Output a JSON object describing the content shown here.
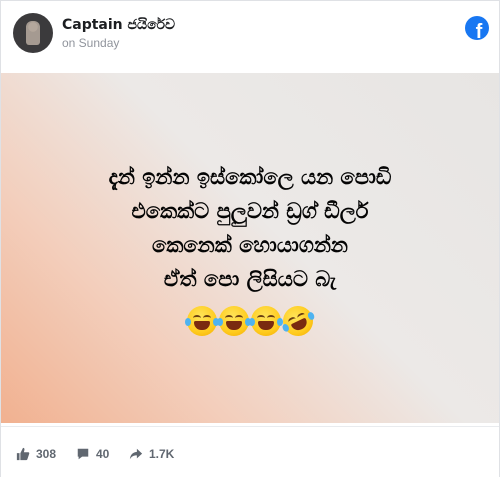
{
  "post": {
    "author": "Captain ජයිරේව",
    "timestamp": "on Sunday",
    "text_lines": [
      "දැන් ඉන්න ඉස්කෝලෙ යන පොඩි",
      "එකෙක්ට පුලුවන් ඩ්‍රග් ඩීලර්",
      "කෙනෙක් හොයාගන්න",
      "ඒත් පො ලිසියට බැ"
    ]
  },
  "stats": {
    "likes": "308",
    "comments": "40",
    "shares": "1.7K"
  },
  "icons": {
    "brand": "facebook-icon",
    "like": "thumbs-up-icon",
    "comment": "comment-icon",
    "share": "share-arrow-icon",
    "emoji": [
      "tears-of-joy-emoji",
      "tears-of-joy-emoji",
      "tears-of-joy-emoji",
      "rolling-laughing-emoji"
    ]
  },
  "colors": {
    "brand": "#1877f2",
    "gradient_start": "#f1b190",
    "gradient_end": "#e7e5e3"
  }
}
